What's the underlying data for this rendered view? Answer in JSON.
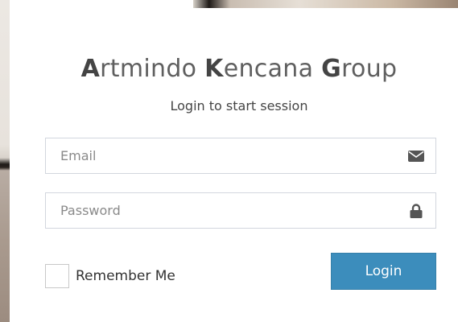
{
  "brand": {
    "part1_initial": "A",
    "part1_rest": "rtmindo ",
    "part2_initial": "K",
    "part2_rest": "encana ",
    "part3_initial": "G",
    "part3_rest": "roup"
  },
  "subtitle": "Login to start session",
  "email": {
    "placeholder": "Email",
    "value": "",
    "icon": "envelope-icon"
  },
  "password": {
    "placeholder": "Password",
    "value": "",
    "icon": "lock-icon"
  },
  "remember": {
    "label": "Remember Me",
    "checked": false
  },
  "login_button": {
    "label": "Login",
    "color": "#3c8dbc"
  }
}
